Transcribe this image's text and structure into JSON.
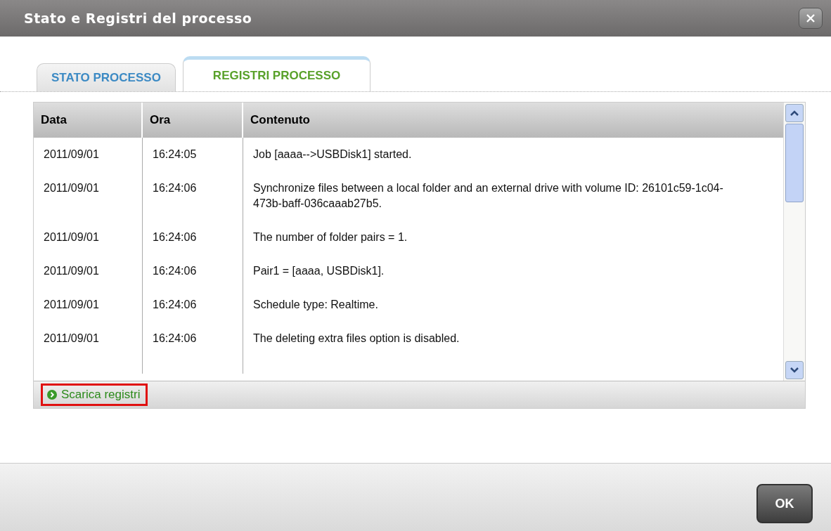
{
  "window": {
    "title": "Stato e Registri del processo"
  },
  "tabs": [
    {
      "label": "STATO PROCESSO",
      "selected": false
    },
    {
      "label": "REGISTRI PROCESSO",
      "selected": true
    }
  ],
  "table": {
    "columns": [
      "Data",
      "Ora",
      "Contenuto"
    ],
    "rows": [
      {
        "date": "2011/09/01",
        "time": "16:24:05",
        "content": "Job [aaaa-->USBDisk1] started."
      },
      {
        "date": "2011/09/01",
        "time": "16:24:06",
        "content": "Synchronize files between a local folder and an external drive with volume ID: 26101c59-1c04-473b-baff-036caaab27b5."
      },
      {
        "date": "2011/09/01",
        "time": "16:24:06",
        "content": "The number of folder pairs = 1."
      },
      {
        "date": "2011/09/01",
        "time": "16:24:06",
        "content": "Pair1 = [aaaa, USBDisk1]."
      },
      {
        "date": "2011/09/01",
        "time": "16:24:06",
        "content": "Schedule type: Realtime."
      },
      {
        "date": "2011/09/01",
        "time": "16:24:06",
        "content": "The deleting extra files option is disabled."
      }
    ]
  },
  "download_link": {
    "label": "Scarica registri",
    "highlighted": true
  },
  "buttons": [
    "OK"
  ]
}
